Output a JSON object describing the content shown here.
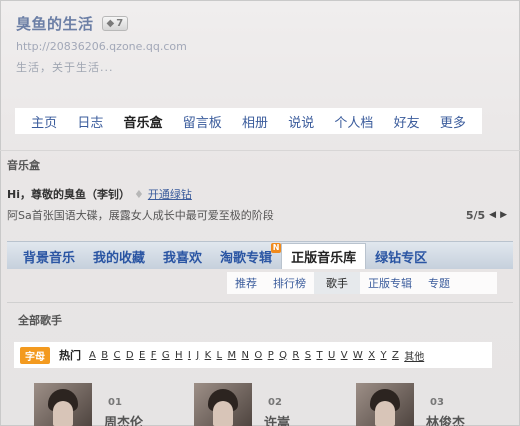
{
  "header": {
    "title": "臭鱼的生活",
    "vip_level": "7",
    "url": "http://20836206.qzone.qq.com",
    "motto": "生活，关于生活..."
  },
  "nav": {
    "items": [
      {
        "label": "主页"
      },
      {
        "label": "日志"
      },
      {
        "label": "音乐盒",
        "active": true
      },
      {
        "label": "留言板"
      },
      {
        "label": "相册"
      },
      {
        "label": "说说"
      },
      {
        "label": "个人档"
      },
      {
        "label": "好友"
      },
      {
        "label": "更多"
      }
    ]
  },
  "section": {
    "title": "音乐盒",
    "greeting": "Hi，尊敬的臭鱼（李钊）",
    "upgrade_link": "开通绿钻",
    "news_text": "阿Sa首张国语大碟，展露女人成长中最可爱至极的阶段",
    "pager": "5/5"
  },
  "tabs": [
    {
      "label": "背景音乐"
    },
    {
      "label": "我的收藏"
    },
    {
      "label": "我喜欢"
    },
    {
      "label": "淘歌专辑",
      "badge": "N"
    },
    {
      "label": "正版音乐库",
      "active": true
    },
    {
      "label": "绿钻专区"
    }
  ],
  "subnav": [
    {
      "label": "推荐"
    },
    {
      "label": "排行榜"
    },
    {
      "label": "歌手",
      "active": true
    },
    {
      "label": "正版专辑"
    },
    {
      "label": "专题"
    }
  ],
  "singers": {
    "title": "全部歌手",
    "alpha_tag": "字母",
    "hot_label": "热门",
    "letters": [
      "A",
      "B",
      "C",
      "D",
      "E",
      "F",
      "G",
      "H",
      "I",
      "J",
      "K",
      "L",
      "M",
      "N",
      "O",
      "P",
      "Q",
      "R",
      "S",
      "T",
      "U",
      "V",
      "W",
      "X",
      "Y",
      "Z"
    ],
    "other_label": "其他",
    "cards": [
      {
        "rank": "01",
        "name": "周杰伦"
      },
      {
        "rank": "02",
        "name": "许嵩"
      },
      {
        "rank": "03",
        "name": "林俊杰"
      }
    ]
  },
  "colors": {
    "link": "#3b5c9c",
    "accent_orange": "#f39a1f",
    "tab_text": "#2a55a3"
  }
}
